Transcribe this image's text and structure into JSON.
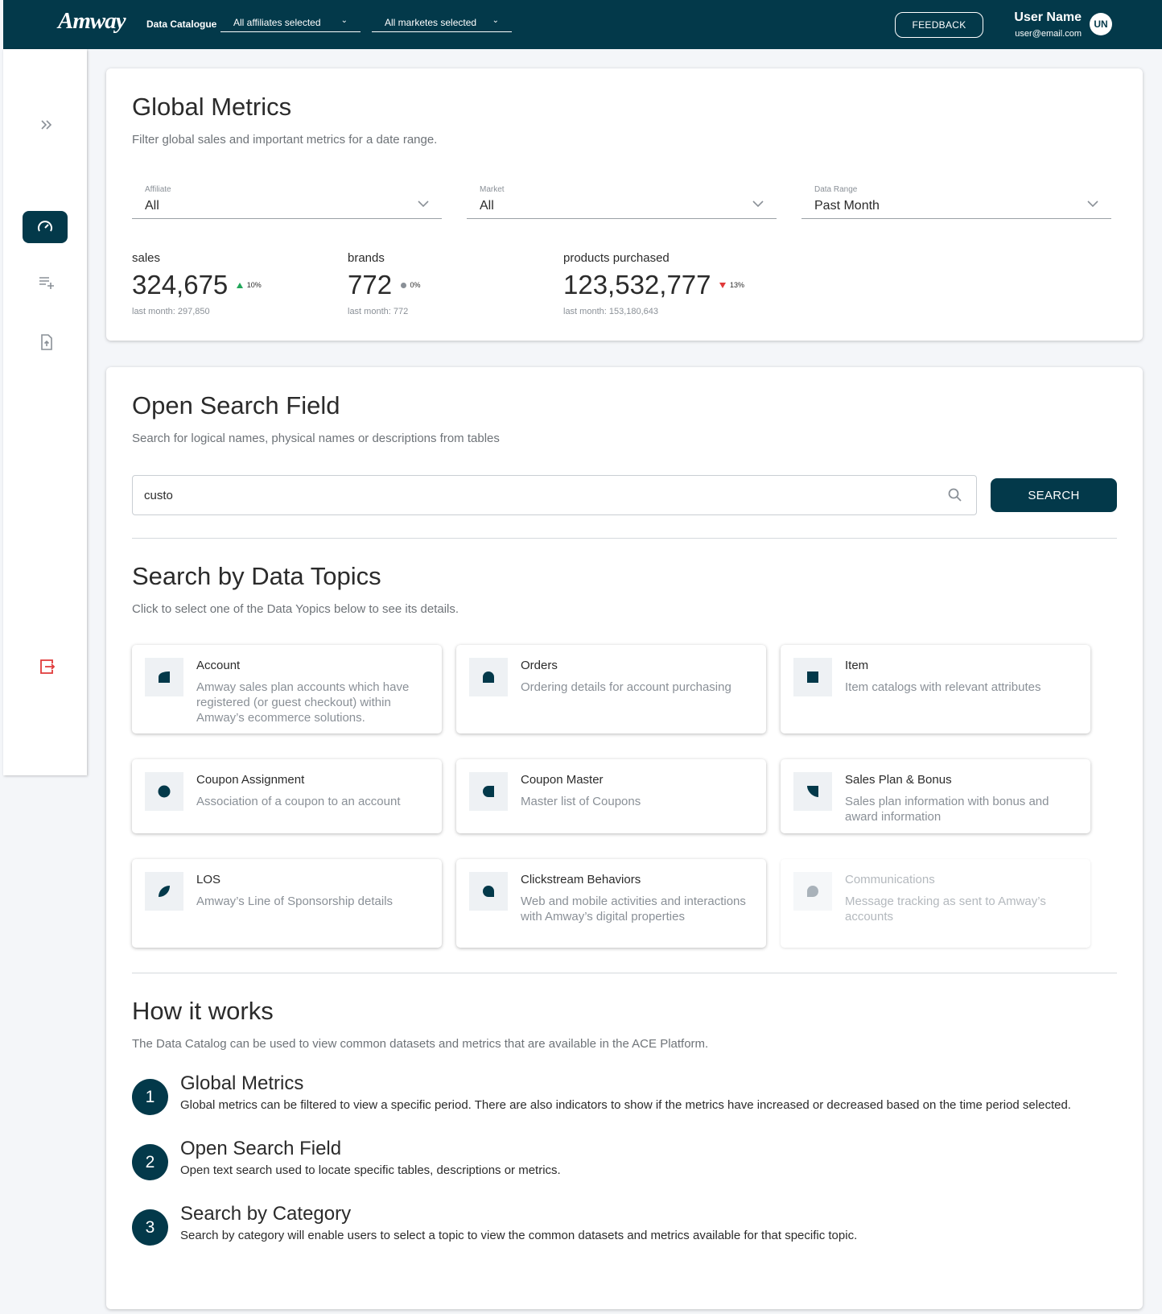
{
  "header": {
    "logo": "Amway",
    "app_name": "Data Catalogue",
    "affiliates_select": "All affiliates selected",
    "markets_select": "All marketes selected",
    "feedback_label": "FEEDBACK",
    "user_name": "User Name",
    "user_email": "user@email.com",
    "avatar_initials": "UN",
    "brand_color": "#03394a"
  },
  "sidebar": {
    "items": [
      {
        "icon": "double-chevron-right-icon"
      },
      {
        "icon": "speedometer-icon",
        "active": true
      },
      {
        "icon": "playlist-add-icon"
      },
      {
        "icon": "file-upload-icon"
      },
      {
        "icon": "logout-icon",
        "color": "#e03a3a"
      }
    ]
  },
  "global_metrics": {
    "title": "Global Metrics",
    "subtitle": "Filter global sales and important metrics for a date range.",
    "filters": [
      {
        "label": "Affiliate",
        "value": "All"
      },
      {
        "label": "Market",
        "value": "All"
      },
      {
        "label": "Data Range",
        "value": "Past Month"
      }
    ],
    "metrics": [
      {
        "label": "sales",
        "value": "324,675",
        "trend": "up",
        "change": "10%",
        "last": "last month: 297,850"
      },
      {
        "label": "brands",
        "value": "772",
        "trend": "flat",
        "change": "0%",
        "last": "last month: 772"
      },
      {
        "label": "products purchased",
        "value": "123,532,777",
        "trend": "down",
        "change": "13%",
        "last": "last month: 153,180,643"
      }
    ]
  },
  "search": {
    "title": "Open Search Field",
    "subtitle": "Search for logical names, physical names or descriptions from tables",
    "query": "custo",
    "button_label": "SEARCH"
  },
  "topics": {
    "title": "Search by Data Topics",
    "subtitle": "Click to select one of the Data Yopics below to see its details.",
    "items": [
      {
        "name": "Account",
        "desc": "Amway sales plan accounts which have registered (or guest checkout) within Amway’s ecommerce solutions."
      },
      {
        "name": "Orders",
        "desc": "Ordering details for account purchasing"
      },
      {
        "name": "Item",
        "desc": "Item catalogs with relevant attributes"
      },
      {
        "name": "Coupon Assignment",
        "desc": "Association of a coupon to an account"
      },
      {
        "name": "Coupon Master",
        "desc": "Master list of Coupons"
      },
      {
        "name": "Sales Plan & Bonus",
        "desc": "Sales plan information with bonus and award information"
      },
      {
        "name": "LOS",
        "desc": "Amway’s Line of Sponsorship details"
      },
      {
        "name": "Clickstream Behaviors",
        "desc": "Web and mobile activities and interactions with Amway’s digital properties"
      },
      {
        "name": "Communications",
        "desc": "Message tracking as sent to Amway’s accounts",
        "disabled": true
      }
    ]
  },
  "how_it_works": {
    "title": "How it works",
    "subtitle": "The Data Catalog can be used to view common datasets and metrics that are available in the ACE Platform.",
    "steps": [
      {
        "num": "1",
        "title": "Global Metrics",
        "desc": "Global metrics can be filtered to view a specific period. There are also indicators to show if the metrics have increased or decreased based on the time period selected."
      },
      {
        "num": "2",
        "title": "Open Search Field",
        "desc": "Open text search used to locate specific tables, descriptions or metrics."
      },
      {
        "num": "3",
        "title": "Search by Category",
        "desc": "Search by category will enable users to select a topic to view the common datasets and metrics available for that specific topic."
      }
    ]
  }
}
